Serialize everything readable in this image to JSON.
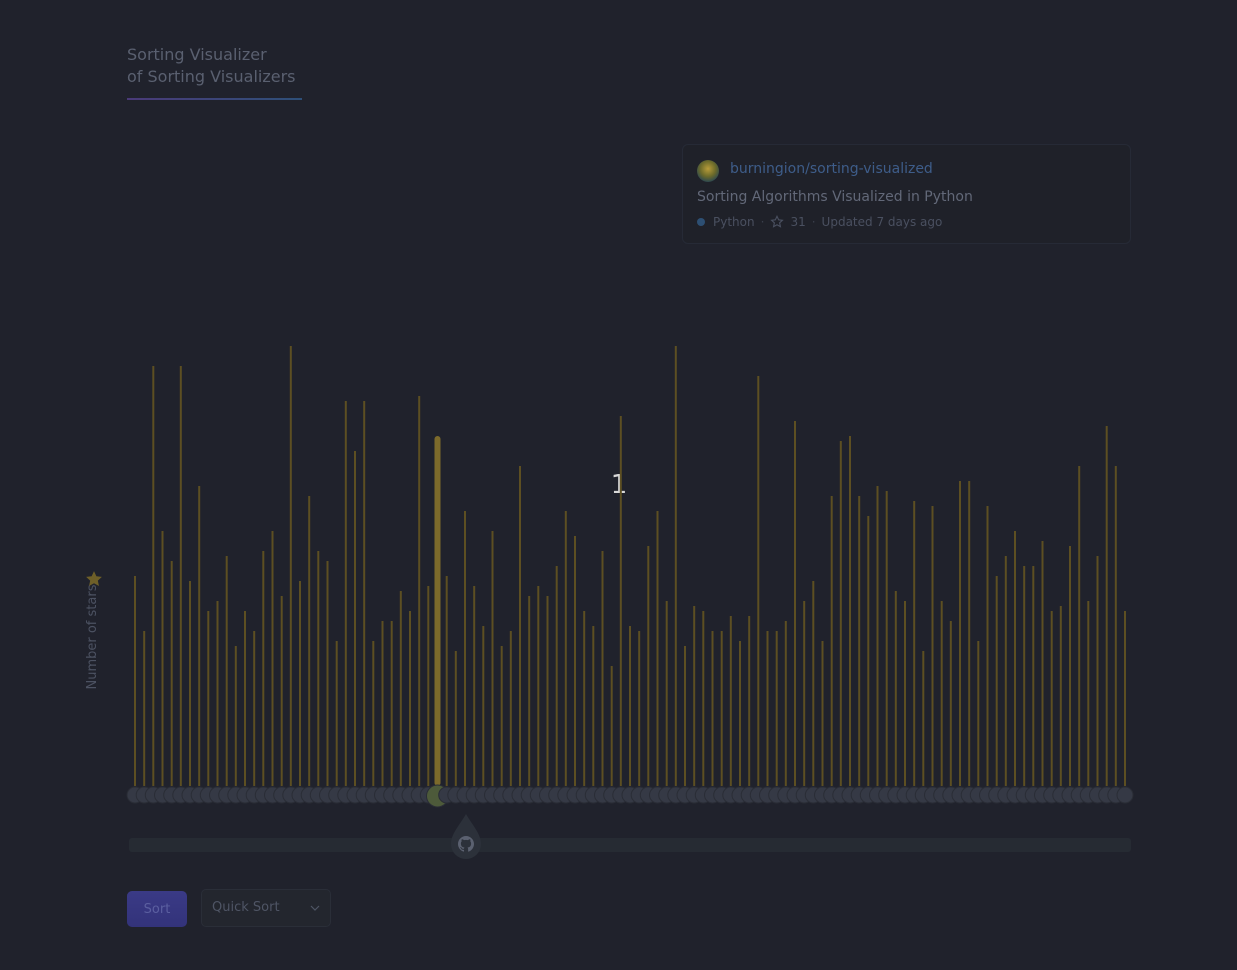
{
  "header": {
    "title_line1": "Sorting Visualizer",
    "title_line2": "of Sorting Visualizers"
  },
  "repo_card": {
    "repo_name": "burningion/sorting-visualized",
    "description": "Sorting Algorithms Visualized in Python",
    "language": "Python",
    "stars": "31",
    "updated": "Updated 7 days ago",
    "language_color": "#2d4f73"
  },
  "step_counter": "1",
  "axis": {
    "ylabel": "Number of stars"
  },
  "controls": {
    "sort_label": "Sort",
    "algorithm_selected": "Quick Sort"
  },
  "chart_data": {
    "type": "bar",
    "ylabel": "Number of stars",
    "active_index": 33,
    "values": [
      42,
      31,
      84,
      51,
      45,
      84,
      41,
      60,
      35,
      37,
      46,
      28,
      35,
      31,
      47,
      51,
      38,
      88,
      41,
      58,
      47,
      45,
      29,
      77,
      67,
      77,
      29,
      33,
      33,
      39,
      35,
      78,
      40,
      70,
      42,
      27,
      55,
      40,
      32,
      51,
      28,
      31,
      64,
      38,
      40,
      38,
      44,
      55,
      50,
      35,
      32,
      47,
      24,
      74,
      32,
      31,
      48,
      55,
      37,
      88,
      28,
      36,
      35,
      31,
      31,
      34,
      29,
      34,
      82,
      31,
      31,
      33,
      73,
      37,
      41,
      29,
      58,
      69,
      70,
      58,
      54,
      60,
      59,
      39,
      37,
      57,
      27,
      56,
      37,
      33,
      61,
      61,
      29,
      56,
      42,
      46,
      51,
      44,
      44,
      49,
      35,
      36,
      48,
      64,
      37,
      46,
      72,
      64,
      35
    ],
    "colors": {
      "bar": "#5d4f22",
      "bar_active": "#7c6a2b",
      "avatar": "#353945"
    }
  }
}
